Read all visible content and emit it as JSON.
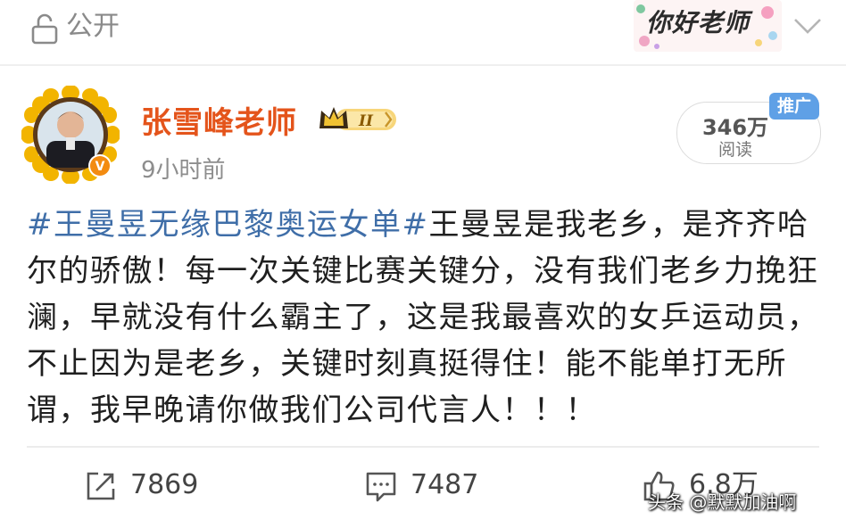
{
  "header": {
    "visibility_label": "公开",
    "badge_text": "你好老师"
  },
  "author": {
    "name": "张雪峰老师",
    "vip_level": "II",
    "verified": true,
    "time": "9小时前"
  },
  "stats_card": {
    "reads": "346万",
    "reads_label": "阅读",
    "promo_label": "推广"
  },
  "post": {
    "hashtag": "#王曼昱无缘巴黎奥运女单#",
    "text": "王曼昱是我老乡，是齐齐哈尔的骄傲！每一次关键比赛关键分，没有我们老乡力挽狂澜，早就没有什么霸主了，这是我最喜欢的女乒运动员，不止因为是老乡，关键时刻真挺得住！能不能单打无所谓，我早晚请你做我们公司代言人！！！"
  },
  "actions": {
    "repost_count": "7869",
    "comment_count": "7487",
    "like_count": "6.8万"
  },
  "watermark": "头条 @默默加油啊",
  "colors": {
    "author_name": "#e4541b",
    "hashtag": "#3f6ea8",
    "promo_tag": "#5fa0e6"
  }
}
